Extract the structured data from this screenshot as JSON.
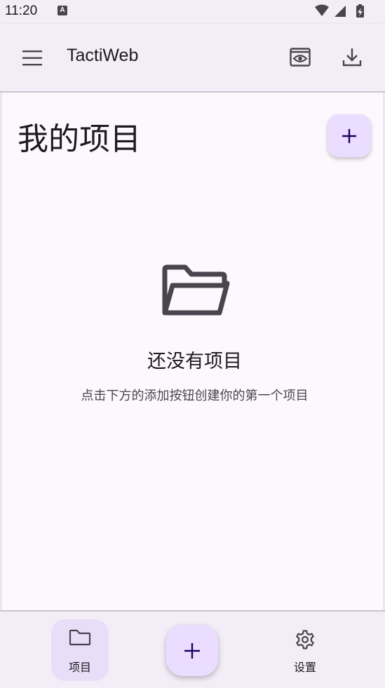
{
  "status_bar": {
    "time": "11:20",
    "notification_icon": "A"
  },
  "app_bar": {
    "title": "TactiWeb"
  },
  "main": {
    "page_title": "我的项目",
    "empty_state": {
      "title": "还没有项目",
      "subtitle": "点击下方的添加按钮创建你的第一个项目"
    }
  },
  "bottom_nav": {
    "projects_label": "项目",
    "settings_label": "设置"
  },
  "colors": {
    "surface": "#fdf8fd",
    "app_bar": "#f3edf7",
    "fab": "#eaddff",
    "nav_indicator": "#e8def8",
    "icon": "#49454f",
    "on_fab": "#21005d"
  },
  "icons": {
    "menu": "hamburger-menu-icon",
    "preview": "eye-icon",
    "download": "download-icon",
    "add": "plus-icon",
    "empty": "folder-open-icon",
    "nav_projects": "folder-icon",
    "nav_settings": "gear-icon"
  }
}
